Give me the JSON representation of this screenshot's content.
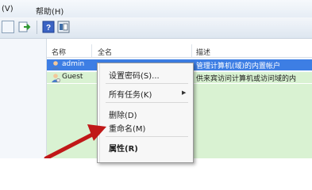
{
  "menubar": {
    "view_label": "(V)",
    "help_label": "帮助(H)"
  },
  "columns": {
    "name": "名称",
    "fullname": "全名",
    "description": "描述"
  },
  "users": [
    {
      "name": "admin",
      "description": "管理计算机(域)的内置帐户"
    },
    {
      "name": "Guest",
      "description": "供来宾访问计算机或访问域的内"
    }
  ],
  "context_menu": {
    "set_password": "设置密码(S)...",
    "all_tasks": "所有任务(K)",
    "delete": "删除(D)",
    "rename": "重命名(M)",
    "properties": "属性(R)"
  },
  "icons": {
    "toolbar": [
      "list-icon",
      "export-icon",
      "help-icon",
      "view-icon"
    ],
    "user": "user-icon",
    "submenu": "chevron-right-icon",
    "annotation": "arrow-icon"
  },
  "colors": {
    "selection": "#3d7ee4",
    "list_background": "#d9f2d2",
    "annotation_arrow": "#c01818"
  }
}
